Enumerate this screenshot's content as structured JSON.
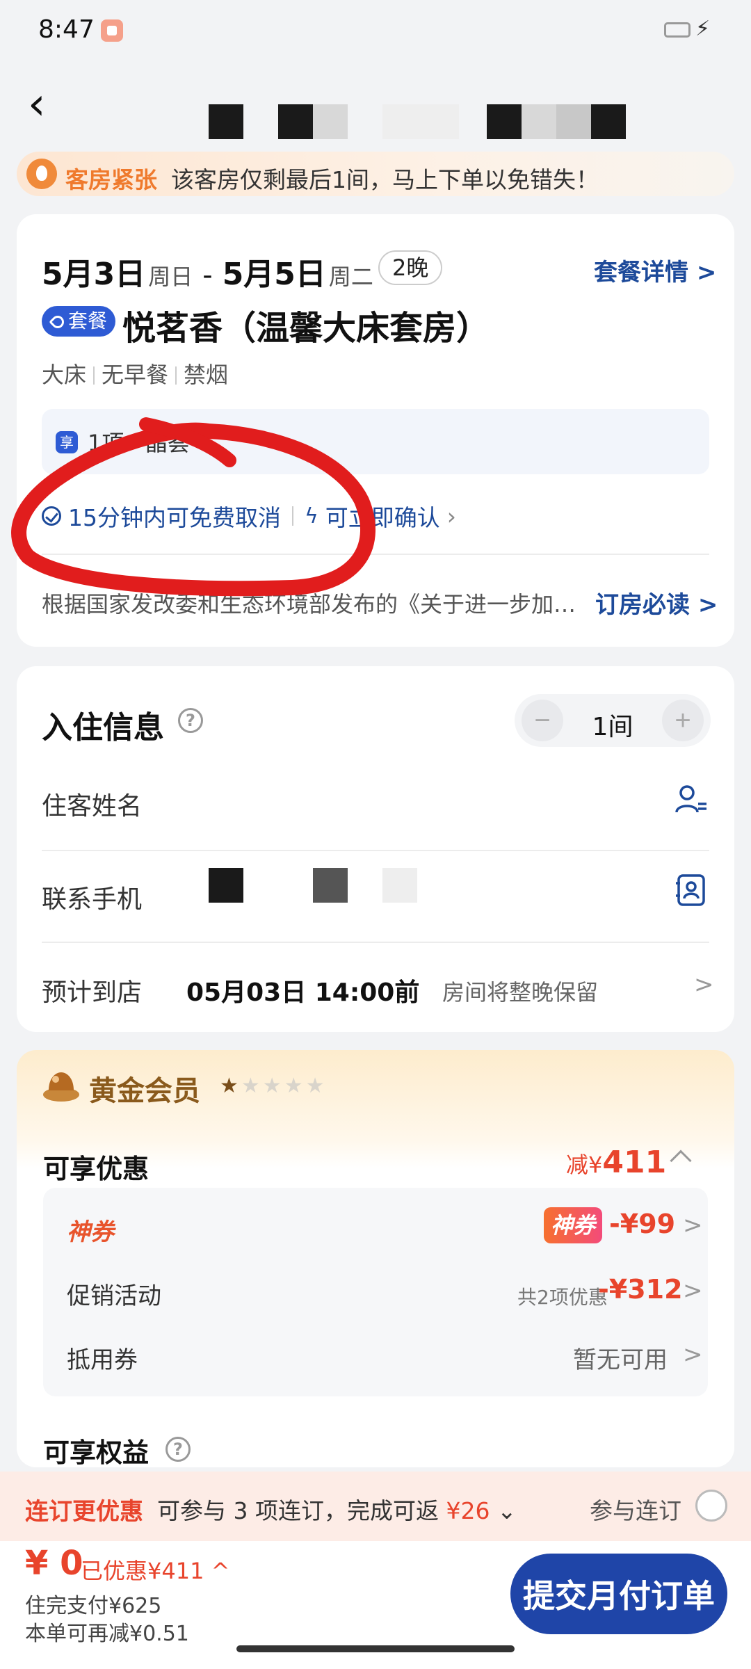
{
  "status_bar": {
    "time": "8:47"
  },
  "banner": {
    "tag": "客房紧张",
    "message": "该客房仅剩最后1间，马上下单以免错失！"
  },
  "booking": {
    "checkin_date": "5月3日",
    "checkin_weekday": "周日",
    "checkout_date": "5月5日",
    "checkout_weekday": "周二",
    "date_separator": "-",
    "nights": "2晚",
    "detail_link": "套餐详情 >",
    "package_badge": "套餐",
    "room_name": "悦茗香（温馨大床套房）",
    "tags": [
      "大床",
      "无早餐",
      "禁烟"
    ],
    "gift_icon": "享",
    "gift_text": "1项 · 晶荟",
    "cancel_policy": "15分钟内可免费取消",
    "instant_confirm": "可立即确认",
    "notice": "根据国家发改委和生态环境部发布的《关于进一步加强塑料污染治理的意见》",
    "must_read": "订房必读 >"
  },
  "checkin": {
    "title": "入住信息",
    "help": "?",
    "rooms_value": "1间",
    "minus": "−",
    "plus": "+",
    "guest_label": "住客姓名",
    "guest_placeholder": "",
    "phone_label": "联系手机",
    "arrival_label": "预计到店",
    "arrival_value": "05月03日 14:00前",
    "arrival_hint": "房间将整晚保留",
    "chevron": ">"
  },
  "member": {
    "level": "黄金会员",
    "stars_filled": 1,
    "stars_total": 5,
    "benefits_title": "可享优惠",
    "saving_prefix": "减¥",
    "saving_amount": "411",
    "shenquan_label": "神券",
    "shenquan_badge": "神券",
    "shenquan_amount": "-¥99",
    "promo_label": "促销活动",
    "promo_note": "共2项优惠",
    "promo_amount": "-¥312",
    "coupon_label": "抵用券",
    "coupon_value": "暂无可用",
    "chevron": ">",
    "rights_title": "可享权益"
  },
  "stay_promo": {
    "tag": "连订更优惠",
    "message": "可参与 3 项连订，完成可返",
    "amount": "¥26",
    "join_label": "参与连订"
  },
  "footer": {
    "pay_amount": "¥ 0",
    "saved": "已优惠¥411",
    "after_stay": "住完支付¥625",
    "extra_saving": "本单可再减¥0.51",
    "submit": "提交月付订单"
  },
  "colors": {
    "accent_blue": "#1f45a8",
    "link_blue": "#1d4a9a",
    "price_red": "#e8442c",
    "warning_orange": "#ef7a2d",
    "annotation_red": "#e11d1d"
  }
}
